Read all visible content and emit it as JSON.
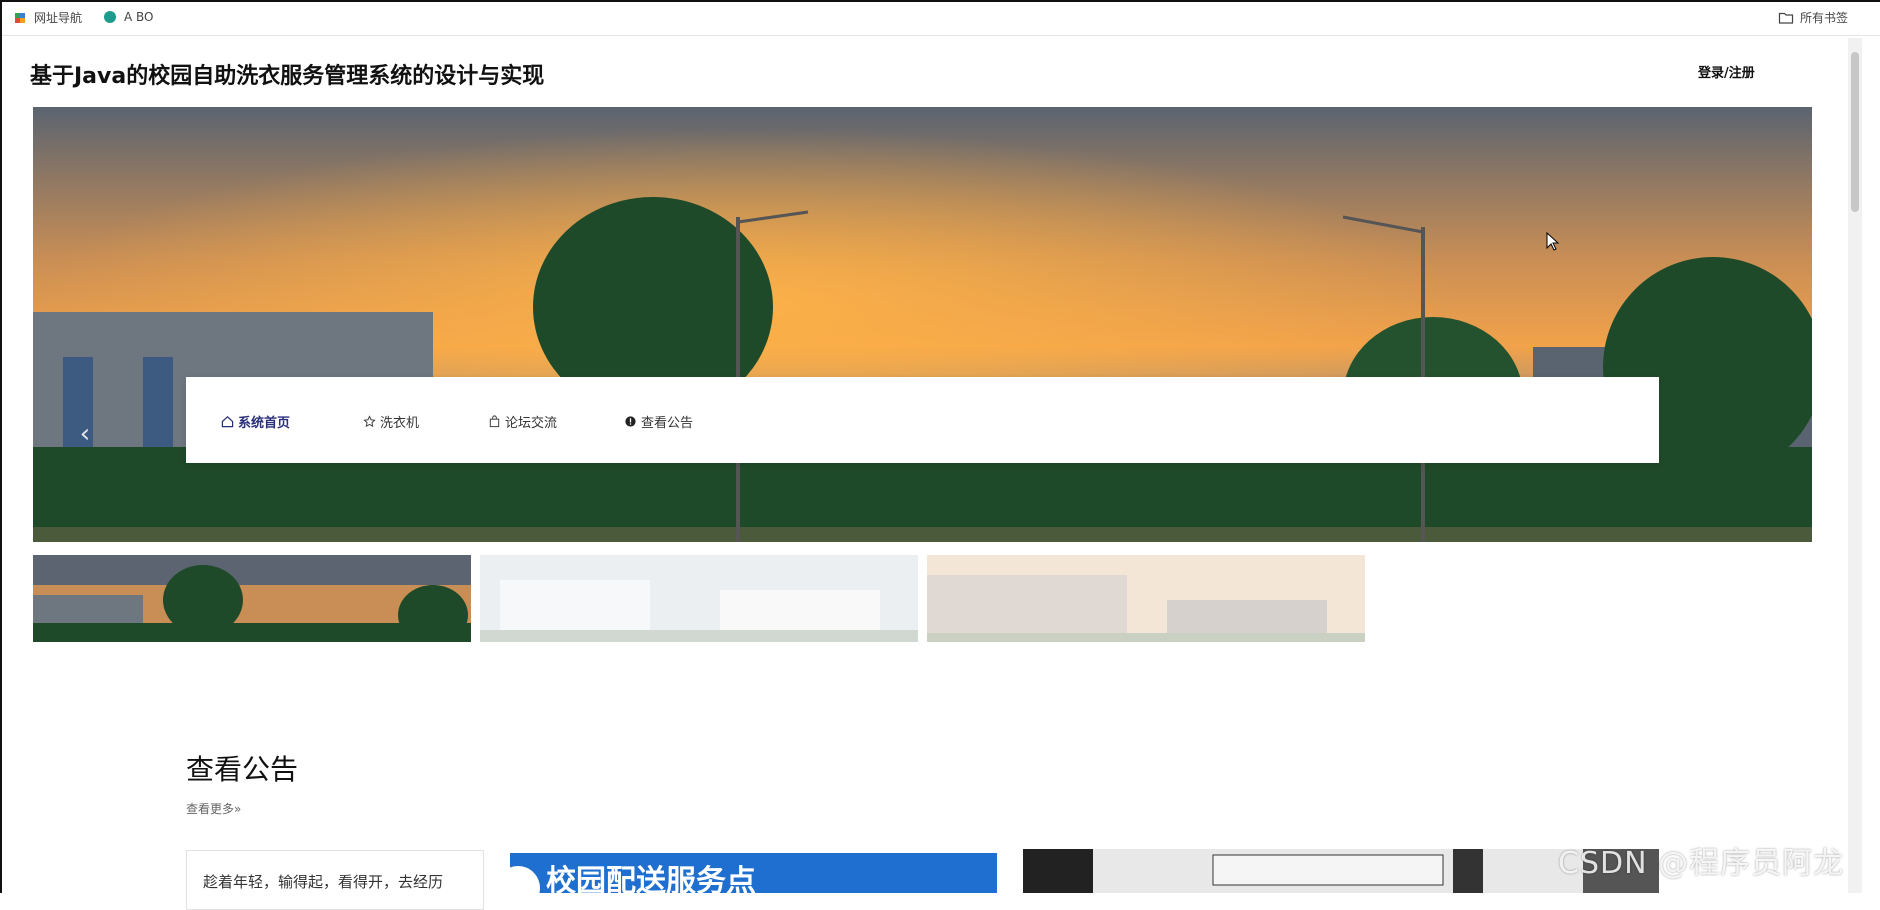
{
  "bookmarks": {
    "nav_label": "网址导航",
    "abo_label": "A BO",
    "all_label": "所有书签"
  },
  "header": {
    "title": "基于Java的校园自助洗衣服务管理系统的设计与实现",
    "login_label": "登录/注册"
  },
  "nav": {
    "items": [
      {
        "label": "系统首页",
        "icon": "home-icon",
        "active": true
      },
      {
        "label": "洗衣机",
        "icon": "star-icon",
        "active": false
      },
      {
        "label": "论坛交流",
        "icon": "bag-icon",
        "active": false
      },
      {
        "label": "查看公告",
        "icon": "info-icon",
        "active": false
      }
    ]
  },
  "notice": {
    "section_title": "查看公告",
    "more_label": "查看更多»",
    "card_text": "趁着年轻，输得起，看得开，去经历",
    "image_card_text": "校园配送服务点"
  },
  "watermark": "CSDN @程序员阿龙",
  "colors": {
    "accent": "#2a2f7a",
    "sky_top": "#5b6470",
    "sunset": "#f2a24a",
    "foliage": "#1f4a2a"
  }
}
